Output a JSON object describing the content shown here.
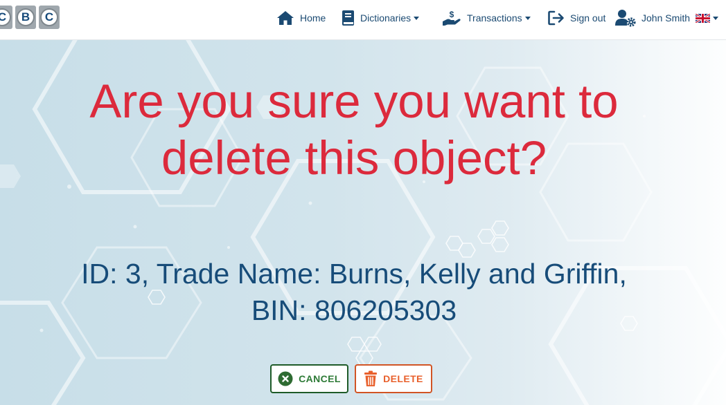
{
  "logo": {
    "letters": [
      "C",
      "B",
      "C"
    ]
  },
  "nav": {
    "home": "Home",
    "dictionaries": "Dictionaries",
    "transactions": "Transactions",
    "sign_out": "Sign out",
    "user": "John Smith"
  },
  "confirm": {
    "question_line1": "Are you sure you want to",
    "question_line2": "delete this object?",
    "details_line1": "ID: 3, Trade Name: Burns, Kelly and Griffin,",
    "details_line2": "BIN: 806205303"
  },
  "buttons": {
    "cancel": "CANCEL",
    "delete": "DELETE"
  },
  "colors": {
    "nav_text": "#1b4a72",
    "question": "#dc2a3c",
    "details": "#174c79",
    "cancel": "#2d7a36",
    "delete": "#e8602c"
  }
}
